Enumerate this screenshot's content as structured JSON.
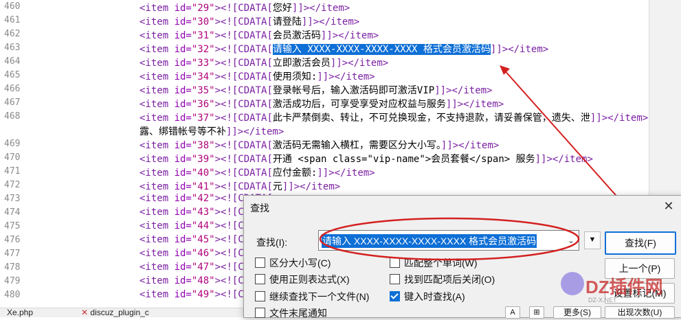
{
  "editor": {
    "lines": [
      {
        "num": "460",
        "id": "29",
        "text": "您好"
      },
      {
        "num": "461",
        "id": "30",
        "text": "请登陆"
      },
      {
        "num": "462",
        "id": "31",
        "text": "会员激活码"
      },
      {
        "num": "463",
        "id": "32",
        "text": "请输入 XXXX-XXXX-XXXX-XXXX 格式会员激活码"
      },
      {
        "num": "464",
        "id": "33",
        "text": "立即激活会员"
      },
      {
        "num": "465",
        "id": "34",
        "text": "使用须知:"
      },
      {
        "num": "466",
        "id": "35",
        "text": "登录帐号后，输入激活码即可激活VIP"
      },
      {
        "num": "467",
        "id": "36",
        "text": "激活成功后，可享受享受对应权益与服务"
      },
      {
        "num": "468",
        "id": "37",
        "text": "此卡严禁倒卖、转让，不可兑换现金，不支持退款，请妥善保管，遗失、泄"
      },
      {
        "num": "",
        "id": "",
        "text": "露、绑错帐号等不补"
      },
      {
        "num": "469",
        "id": "38",
        "text": "激活码无需输入横杠，需要区分大小写。"
      },
      {
        "num": "470",
        "id": "39",
        "text": "开通 <span class=\"vip-name\">会员套餐</span> 服务"
      },
      {
        "num": "471",
        "id": "40",
        "text": "应付金额:"
      },
      {
        "num": "472",
        "id": "41",
        "text": "元"
      },
      {
        "num": "473",
        "id": "42",
        "text": ""
      },
      {
        "num": "474",
        "id": "43",
        "text": ""
      },
      {
        "num": "475",
        "id": "44",
        "text": ""
      },
      {
        "num": "476",
        "id": "45",
        "text": ""
      },
      {
        "num": "477",
        "id": "46",
        "text": ""
      },
      {
        "num": "478",
        "id": "47",
        "text": ""
      },
      {
        "num": "479",
        "id": "48",
        "text": ""
      },
      {
        "num": "480",
        "id": "49",
        "text": ""
      }
    ]
  },
  "taskbar": {
    "tab1": "Xe.php",
    "tab2": "discuz_plugin_c"
  },
  "find_dialog": {
    "title": "查找",
    "find_label": "查找(I):",
    "find_value": "请输入 XXXX-XXXX-XXXX-XXXX 格式会员激活码",
    "find_next_button": "查找(F)",
    "prev_button": "上一个(P)",
    "bookmark_button": "设置标记(M)",
    "options": {
      "match_case": "区分大小写(C)",
      "whole_word": "匹配整个单词(W)",
      "regex": "使用正则表达式(X)",
      "close_on_match": "找到匹配项后关闭(O)",
      "continue_next_file": "继续查找下一个文件(N)",
      "find_as_type": "键入时查找(A)",
      "end_of_file_notify": "文件末尾通知"
    },
    "bottom_buttons": {
      "more": "更多(S)",
      "count": "出现次数(U)"
    }
  },
  "watermark": {
    "text": "DZ插件网",
    "sub": "DZ-X.NET"
  },
  "colors": {
    "tag": "#7a1fa2",
    "selection": "#0e6fd6",
    "annotation": "#d42020"
  }
}
